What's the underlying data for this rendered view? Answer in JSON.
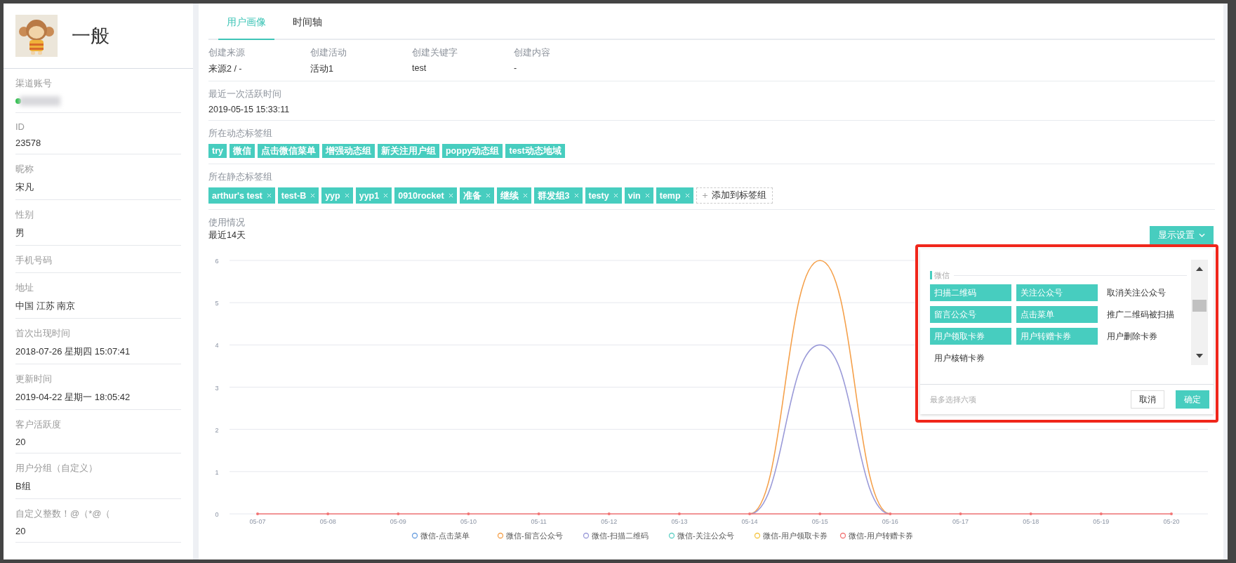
{
  "profile": {
    "name": "一般"
  },
  "fields": [
    {
      "kind": "masked",
      "label": "渠道账号"
    },
    {
      "kind": "text",
      "label": "ID",
      "value": "23578"
    },
    {
      "kind": "text",
      "label": "昵称",
      "value": "宋凡"
    },
    {
      "kind": "text",
      "label": "性别",
      "value": "男"
    },
    {
      "kind": "text",
      "label": "手机号码"
    },
    {
      "kind": "text",
      "label": "地址",
      "value": "中国 江苏 南京"
    },
    {
      "kind": "text",
      "label": "首次出现时间",
      "value": "2018-07-26 星期四 15:07:41"
    },
    {
      "kind": "text",
      "label": "更新时间",
      "value": "2019-04-22 星期一 18:05:42"
    },
    {
      "kind": "text",
      "label": "客户活跃度",
      "value": "20"
    },
    {
      "kind": "text",
      "label": "用户分组（自定义）",
      "value": "B组"
    },
    {
      "kind": "text",
      "label": "自定义整数！@（*@（",
      "value": "20"
    }
  ],
  "tabs": [
    {
      "label": "用户画像",
      "selected": true
    },
    {
      "label": "时间轴",
      "selected": false
    }
  ],
  "creation": [
    {
      "label": "创建来源",
      "value": "来源2 / -"
    },
    {
      "label": "创建活动",
      "value": "活动1"
    },
    {
      "label": "创建关键字",
      "value": "test"
    },
    {
      "label": "创建内容",
      "value": "-"
    }
  ],
  "last_active": {
    "label": "最近一次活跃时间",
    "value": "2019-05-15 15:33:11"
  },
  "dynamic_tags": {
    "label": "所在动态标签组",
    "tags": [
      "try",
      "微信",
      "点击微信菜单",
      "增强动态组",
      "新关注用户组",
      "poppy动态组",
      "test动态地域"
    ]
  },
  "static_tags": {
    "label": "所在静态标签组",
    "tags": [
      "arthur's test",
      "test-B",
      "yyp",
      "yyp1",
      "0910rocket",
      "准备",
      "继续",
      "群发组3",
      "testy",
      "vin",
      "temp"
    ],
    "add_label": "添加到标签组"
  },
  "usage": {
    "label": "使用情况",
    "period": "最近14天",
    "settings_button": "显示设置",
    "chart_data": {
      "type": "line",
      "grid": true,
      "legend": true,
      "categories": [
        "05-07",
        "05-08",
        "05-09",
        "05-10",
        "05-11",
        "05-12",
        "05-13",
        "05-14",
        "05-15",
        "05-16",
        "05-17",
        "05-18",
        "05-19",
        "05-20"
      ],
      "ylim": [
        0,
        6
      ],
      "yticks": [
        0,
        1,
        2,
        3,
        4,
        5,
        6
      ],
      "series": [
        {
          "name": "微信-点击菜单",
          "color": "#6a9fe0",
          "values": [
            null,
            null,
            null,
            null,
            null,
            null,
            null,
            null,
            null,
            null,
            null,
            null,
            null,
            null
          ]
        },
        {
          "name": "微信-留言公众号",
          "color": "#f5a04a",
          "values": [
            null,
            null,
            null,
            null,
            null,
            null,
            null,
            0,
            6,
            0,
            null,
            null,
            null,
            null
          ]
        },
        {
          "name": "微信-扫描二维码",
          "color": "#9a9ad8",
          "values": [
            null,
            null,
            null,
            null,
            null,
            null,
            null,
            0,
            4,
            0,
            null,
            null,
            null,
            null
          ]
        },
        {
          "name": "微信-关注公众号",
          "color": "#5fd0c5",
          "values": [
            null,
            null,
            null,
            null,
            null,
            null,
            null,
            null,
            null,
            null,
            null,
            null,
            null,
            null
          ]
        },
        {
          "name": "微信-用户领取卡券",
          "color": "#f5c542",
          "values": [
            null,
            null,
            null,
            null,
            null,
            null,
            null,
            null,
            null,
            null,
            null,
            null,
            null,
            null
          ]
        },
        {
          "name": "微信-用户转赠卡券",
          "color": "#f27474",
          "values": [
            0,
            0,
            0,
            0,
            0,
            0,
            0,
            0,
            0,
            0,
            0,
            0,
            0,
            0
          ]
        }
      ]
    }
  },
  "display_settings": {
    "group": "微信",
    "options": [
      {
        "label": "扫描二维码",
        "selected": true
      },
      {
        "label": "关注公众号",
        "selected": true
      },
      {
        "label": "取消关注公众号",
        "selected": false
      },
      {
        "label": "留言公众号",
        "selected": true
      },
      {
        "label": "点击菜单",
        "selected": true
      },
      {
        "label": "推广二维码被扫描",
        "selected": false
      },
      {
        "label": "用户领取卡券",
        "selected": true
      },
      {
        "label": "用户转赠卡券",
        "selected": true
      },
      {
        "label": "用户删除卡券",
        "selected": false
      },
      {
        "label": "用户核销卡券",
        "selected": false
      }
    ],
    "hint": "最多选择六项",
    "cancel": "取消",
    "confirm": "确定"
  }
}
